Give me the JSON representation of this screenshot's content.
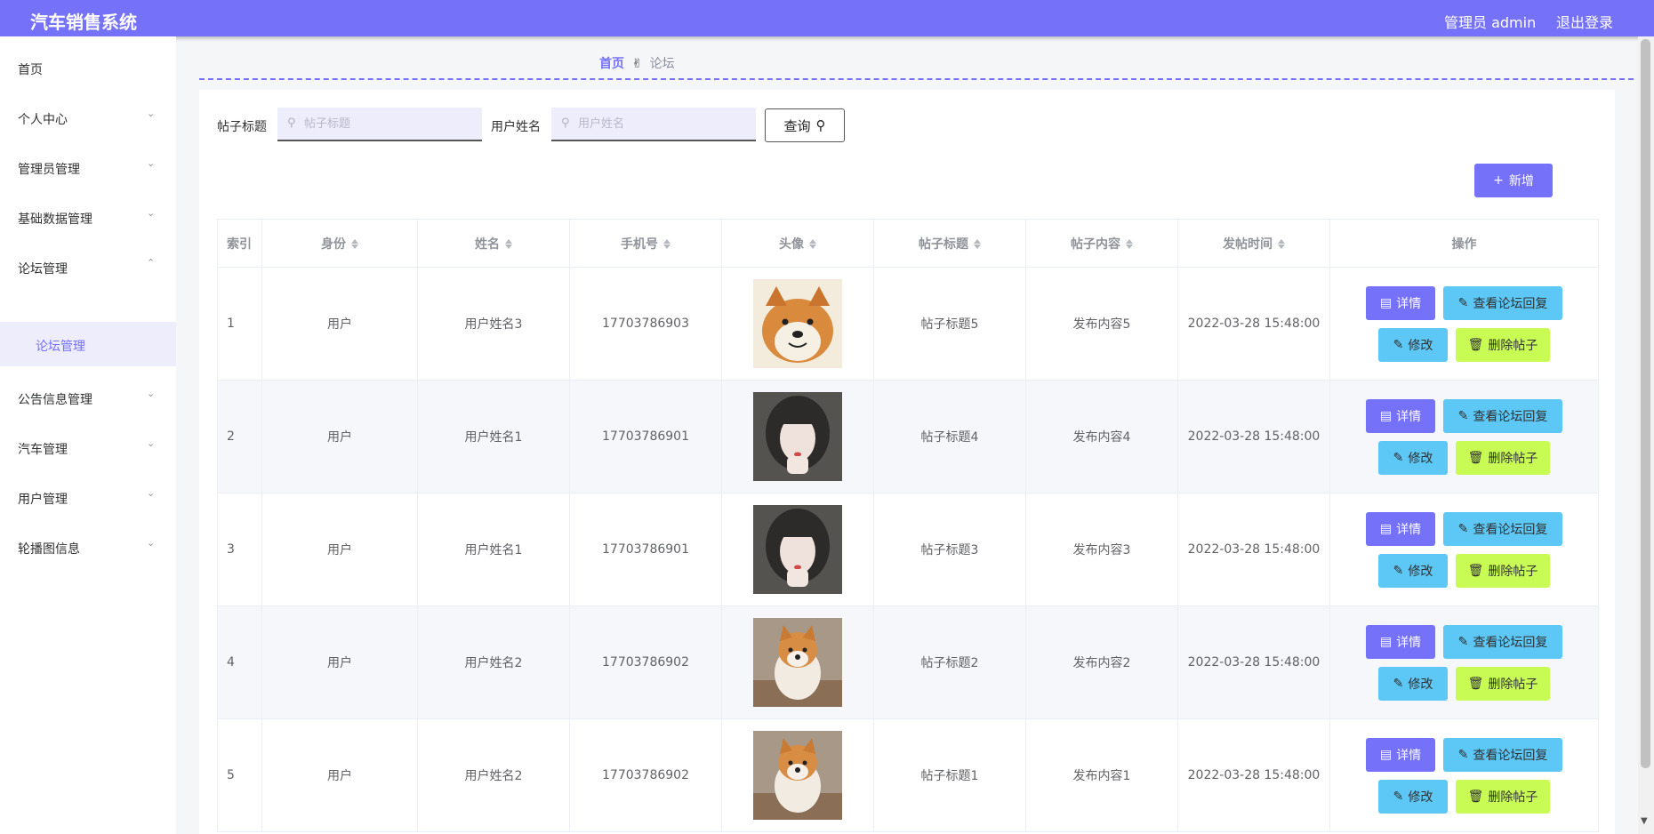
{
  "header": {
    "title": "汽车销售系统",
    "user": "管理员 admin",
    "logout": "退出登录"
  },
  "sidebar": {
    "items": [
      {
        "label": "首页"
      },
      {
        "label": "个人中心"
      },
      {
        "label": "管理员管理"
      },
      {
        "label": "基础数据管理"
      },
      {
        "label": "论坛管理"
      },
      {
        "label": "公告信息管理"
      },
      {
        "label": "汽车管理"
      },
      {
        "label": "用户管理"
      },
      {
        "label": "轮播图信息"
      }
    ],
    "sub_item": "论坛管理",
    "chevron_down": "⌄",
    "chevron_up": "⌃"
  },
  "breadcrumb": {
    "home": "首页",
    "separator_icon": "✌",
    "current": "论坛"
  },
  "search": {
    "title_label": "帖子标题",
    "title_placeholder": "帖子标题",
    "user_label": "用户姓名",
    "user_placeholder": "用户姓名",
    "query_button": "查询",
    "search_icon": "⚲"
  },
  "toolbar": {
    "add_button": "新增",
    "add_icon": "+"
  },
  "table": {
    "headers": [
      "索引",
      "身份",
      "姓名",
      "手机号",
      "头像",
      "帖子标题",
      "帖子内容",
      "发帖时间",
      "操作"
    ],
    "rows": [
      {
        "index": "1",
        "role": "用户",
        "name": "用户姓名3",
        "phone": "17703786903",
        "avatar": "shiba-avatar",
        "title": "帖子标题5",
        "content": "发布内容5",
        "time": "2022-03-28 15:48:00"
      },
      {
        "index": "2",
        "role": "用户",
        "name": "用户姓名1",
        "phone": "17703786901",
        "avatar": "girl-avatar",
        "title": "帖子标题4",
        "content": "发布内容4",
        "time": "2022-03-28 15:48:00"
      },
      {
        "index": "3",
        "role": "用户",
        "name": "用户姓名1",
        "phone": "17703786901",
        "avatar": "girl-avatar",
        "title": "帖子标题3",
        "content": "发布内容3",
        "time": "2022-03-28 15:48:00"
      },
      {
        "index": "4",
        "role": "用户",
        "name": "用户姓名2",
        "phone": "17703786902",
        "avatar": "puppy-avatar",
        "title": "帖子标题2",
        "content": "发布内容2",
        "time": "2022-03-28 15:48:00"
      },
      {
        "index": "5",
        "role": "用户",
        "name": "用户姓名2",
        "phone": "17703786902",
        "avatar": "puppy-avatar",
        "title": "帖子标题1",
        "content": "发布内容1",
        "time": "2022-03-28 15:48:00"
      }
    ],
    "actions": {
      "detail": "详情",
      "reply": "查看论坛回复",
      "edit": "修改",
      "delete": "删除帖子"
    },
    "action_icons": {
      "detail": "▤",
      "reply": "✎",
      "edit": "✎",
      "delete": "🗑"
    }
  },
  "colors": {
    "primary": "#7571f9",
    "info": "#5dc7f5",
    "lime": "#c8fb53"
  }
}
